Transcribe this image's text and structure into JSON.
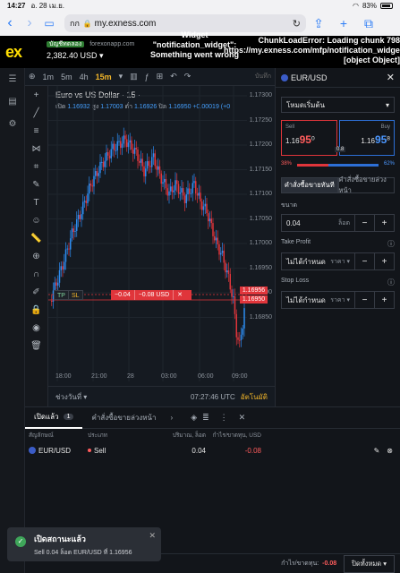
{
  "status": {
    "time": "14:27",
    "date": "อ. 28 เม.ย.",
    "battery": "83%"
  },
  "browser": {
    "tab_label": "กก",
    "host": "my.exness.com",
    "back_icon": "chevron-left-icon",
    "forward_icon": "chevron-right-icon"
  },
  "header": {
    "logo": "ex",
    "account_tag": "บัญชีทดลอง",
    "account_site": "forexonapp.com",
    "balance": "2,382.40 USD",
    "error_widget": "Widget \"notification_widget\": Something went wrong",
    "error_chunk": "ChunkLoadError: Loading chunk 798 https://my.exness.com/mfp/notification_widget [object Object]"
  },
  "chart": {
    "toolbar": [
      "1m",
      "5m",
      "4h",
      "15m"
    ],
    "active_tf": "15m",
    "legend": "Euro vs US Dollar · 15 ·",
    "ohlc": {
      "open_lbl": "เปิด",
      "open": "1.16932",
      "high_lbl": "สูง",
      "high": "1.17003",
      "low_lbl": "ต่ำ",
      "low": "1.16926",
      "close_lbl": "ปิด",
      "close": "1.16950",
      "change": "+0.00019 (+0"
    },
    "y_ticks": [
      "1.17300",
      "1.17250",
      "1.17200",
      "1.17150",
      "1.17100",
      "1.17050",
      "1.17000",
      "1.16950",
      "1.16900",
      "1.16850"
    ],
    "x_ticks": [
      "18:00",
      "21:00",
      "28",
      "03:00",
      "06:00",
      "09:00"
    ],
    "price_label_1": "1.16956",
    "price_label_2": "1.16950",
    "position_line": {
      "tp": "TP",
      "sl": "SL",
      "volume": "−0.04",
      "pnl": "−0.08 USD"
    },
    "bottom": {
      "range_label": "ช่วงวันที่",
      "clock": "07:27:46 UTC",
      "auto": "อัตโนมัติ"
    }
  },
  "order": {
    "symbol": "EUR/USD",
    "mode": "โหมดเริ่มต้น",
    "sell_label": "Sell",
    "sell_price": {
      "prefix": "1.16",
      "big": "95",
      "sup": "0"
    },
    "buy_label": "Buy",
    "buy_price": {
      "prefix": "1.16",
      "big": "95",
      "sup": "8"
    },
    "spread": "0.8",
    "sentiment_left": "38%",
    "sentiment_right": "62%",
    "sell_share": 0.38,
    "tabs": [
      "คำสั่งซื้อขายทันที",
      "คำสั่งซื้อขายล่วงหน้า"
    ],
    "volume_label": "ขนาด",
    "volume_value": "0.04",
    "volume_unit": "ล็อต",
    "tp_label": "Take Profit",
    "tp_value": "ไม่ได้กำหนด",
    "tp_unit": "ราคา ▾",
    "sl_label": "Stop Loss",
    "sl_value": "ไม่ได้กำหนด",
    "sl_unit": "ราคา ▾"
  },
  "positions": {
    "tab_open": "เปิดแล้ว",
    "open_count": "1",
    "tab_pending": "คำสั่งซื้อขายล่วงหน้า",
    "cols": [
      "สัญลักษณ์",
      "ประเภท",
      "ปริมาณ, ล็อต",
      "กำไร/ขาดทุน, USD"
    ],
    "rows": [
      {
        "symbol": "EUR/USD",
        "type": "Sell",
        "volume": "0.04",
        "pnl": "-0.08"
      }
    ],
    "footer_pl_label": "กำไร/ขาดทุน:",
    "footer_pl": "-0.08",
    "close_all": "ปิดทั้งหมด"
  },
  "toast": {
    "title": "เปิดสถานะแล้ว",
    "body": "Sell 0.04 ล็อต EUR/USD ที่ 1.16956"
  }
}
